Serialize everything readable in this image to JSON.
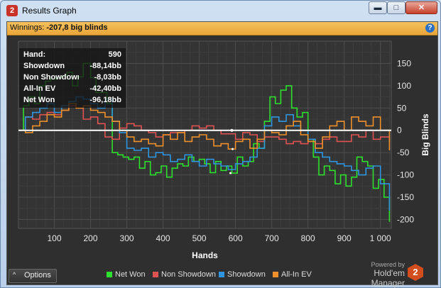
{
  "window": {
    "title": "Results Graph",
    "app_icon": "2"
  },
  "header": {
    "label": "Winnings:",
    "value": "-207,8 big blinds"
  },
  "stats": [
    {
      "label": "Hand:",
      "value": "590"
    },
    {
      "label": "Showdown",
      "value": "-88,14bb"
    },
    {
      "label": "Non Showdown",
      "value": "-8,03bb"
    },
    {
      "label": "All-In EV",
      "value": "-42,40bb"
    },
    {
      "label": "Net Won",
      "value": "-96,18bb"
    }
  ],
  "options_label": "Options",
  "powered_by": "Powered by",
  "brand": "Hold'em Manager",
  "brand_logo": "2",
  "chart_data": {
    "type": "line",
    "xlabel": "Hands",
    "ylabel": "Big Blinds",
    "xlim": [
      1,
      1030
    ],
    "ylim": [
      -220,
      200
    ],
    "xticks": [
      "100",
      "200",
      "300",
      "400",
      "500",
      "600",
      "700",
      "800",
      "900",
      "1 000"
    ],
    "yticks": [
      "150",
      "100",
      "50",
      "0",
      "-50",
      "-100",
      "-150",
      "-200"
    ],
    "grid": true,
    "legend_position": "bottom",
    "series": [
      {
        "name": "Net Won",
        "color": "#2ee02e",
        "x": [
          1,
          15,
          30,
          45,
          60,
          75,
          90,
          105,
          120,
          135,
          150,
          165,
          180,
          200,
          215,
          230,
          245,
          260,
          275,
          290,
          305,
          320,
          335,
          350,
          365,
          380,
          395,
          410,
          425,
          440,
          455,
          470,
          485,
          500,
          515,
          530,
          545,
          560,
          575,
          590,
          605,
          620,
          635,
          650,
          665,
          680,
          695,
          710,
          725,
          740,
          755,
          770,
          785,
          800,
          815,
          830,
          845,
          860,
          875,
          890,
          905,
          920,
          935,
          950,
          965,
          980,
          995,
          1010,
          1025
        ],
        "y": [
          0,
          55,
          75,
          60,
          100,
          110,
          115,
          118,
          122,
          130,
          100,
          120,
          150,
          118,
          85,
          85,
          60,
          -50,
          -55,
          -60,
          -65,
          -60,
          -85,
          -70,
          -100,
          -95,
          -80,
          -105,
          -85,
          -75,
          -80,
          -60,
          -70,
          -65,
          -75,
          -95,
          -70,
          -90,
          -80,
          -96,
          -60,
          -80,
          -70,
          -30,
          -40,
          20,
          75,
          60,
          90,
          100,
          50,
          30,
          40,
          -20,
          -60,
          -100,
          -80,
          -90,
          -120,
          -100,
          -125,
          -105,
          -60,
          -70,
          -80,
          -130,
          -110,
          -150,
          -205
        ]
      },
      {
        "name": "Non Showdown",
        "color": "#e05252",
        "x": [
          1,
          20,
          40,
          60,
          80,
          100,
          120,
          140,
          160,
          180,
          200,
          220,
          240,
          260,
          280,
          300,
          320,
          340,
          360,
          380,
          400,
          420,
          440,
          460,
          480,
          500,
          520,
          540,
          560,
          580,
          600,
          620,
          640,
          660,
          680,
          700,
          720,
          740,
          760,
          780,
          800,
          820,
          840,
          860,
          880,
          900,
          920,
          940,
          960,
          980,
          1000,
          1025
        ],
        "y": [
          0,
          30,
          25,
          35,
          40,
          35,
          45,
          55,
          50,
          25,
          30,
          15,
          -15,
          -20,
          5,
          15,
          10,
          0,
          -5,
          -15,
          -10,
          -5,
          -5,
          0,
          10,
          5,
          10,
          0,
          -8,
          -8,
          -20,
          -5,
          -10,
          -25,
          -15,
          -15,
          -20,
          -30,
          -25,
          -30,
          -20,
          -30,
          -20,
          -15,
          -25,
          -25,
          -10,
          -15,
          0,
          -20,
          -15,
          -25
        ]
      },
      {
        "name": "Showdown",
        "color": "#2f95e0",
        "x": [
          1,
          20,
          40,
          60,
          80,
          100,
          120,
          140,
          160,
          180,
          200,
          220,
          240,
          260,
          280,
          300,
          320,
          340,
          360,
          380,
          400,
          420,
          440,
          460,
          480,
          500,
          520,
          540,
          560,
          580,
          600,
          620,
          640,
          660,
          680,
          700,
          720,
          740,
          760,
          780,
          800,
          820,
          840,
          860,
          880,
          900,
          920,
          940,
          960,
          980,
          1000,
          1025
        ],
        "y": [
          0,
          30,
          40,
          50,
          60,
          40,
          55,
          65,
          75,
          70,
          60,
          50,
          70,
          20,
          -5,
          -40,
          -45,
          -40,
          -60,
          -50,
          -55,
          -70,
          -65,
          -55,
          -70,
          -80,
          -65,
          -75,
          -80,
          -88,
          -75,
          -70,
          -60,
          -40,
          10,
          30,
          20,
          35,
          10,
          0,
          -20,
          -50,
          -60,
          -70,
          -75,
          -80,
          -90,
          -100,
          -85,
          -80,
          -120,
          -180
        ]
      },
      {
        "name": "All-In EV",
        "color": "#f0902a",
        "x": [
          1,
          20,
          40,
          60,
          80,
          100,
          120,
          140,
          160,
          180,
          200,
          220,
          240,
          260,
          280,
          300,
          320,
          340,
          360,
          380,
          400,
          420,
          440,
          460,
          480,
          500,
          520,
          540,
          560,
          580,
          600,
          620,
          640,
          660,
          680,
          700,
          720,
          740,
          760,
          780,
          800,
          820,
          840,
          860,
          880,
          900,
          920,
          940,
          960,
          980,
          1000,
          1025
        ],
        "y": [
          0,
          -5,
          10,
          20,
          35,
          30,
          45,
          60,
          50,
          55,
          45,
          40,
          30,
          20,
          0,
          -15,
          -25,
          -20,
          -30,
          -35,
          -10,
          -20,
          -5,
          -25,
          -15,
          -10,
          -20,
          -35,
          -30,
          -42,
          -25,
          -20,
          -40,
          -20,
          0,
          -5,
          -10,
          10,
          20,
          -10,
          -25,
          -40,
          -15,
          10,
          20,
          0,
          30,
          20,
          10,
          30,
          0,
          -45
        ]
      }
    ]
  }
}
